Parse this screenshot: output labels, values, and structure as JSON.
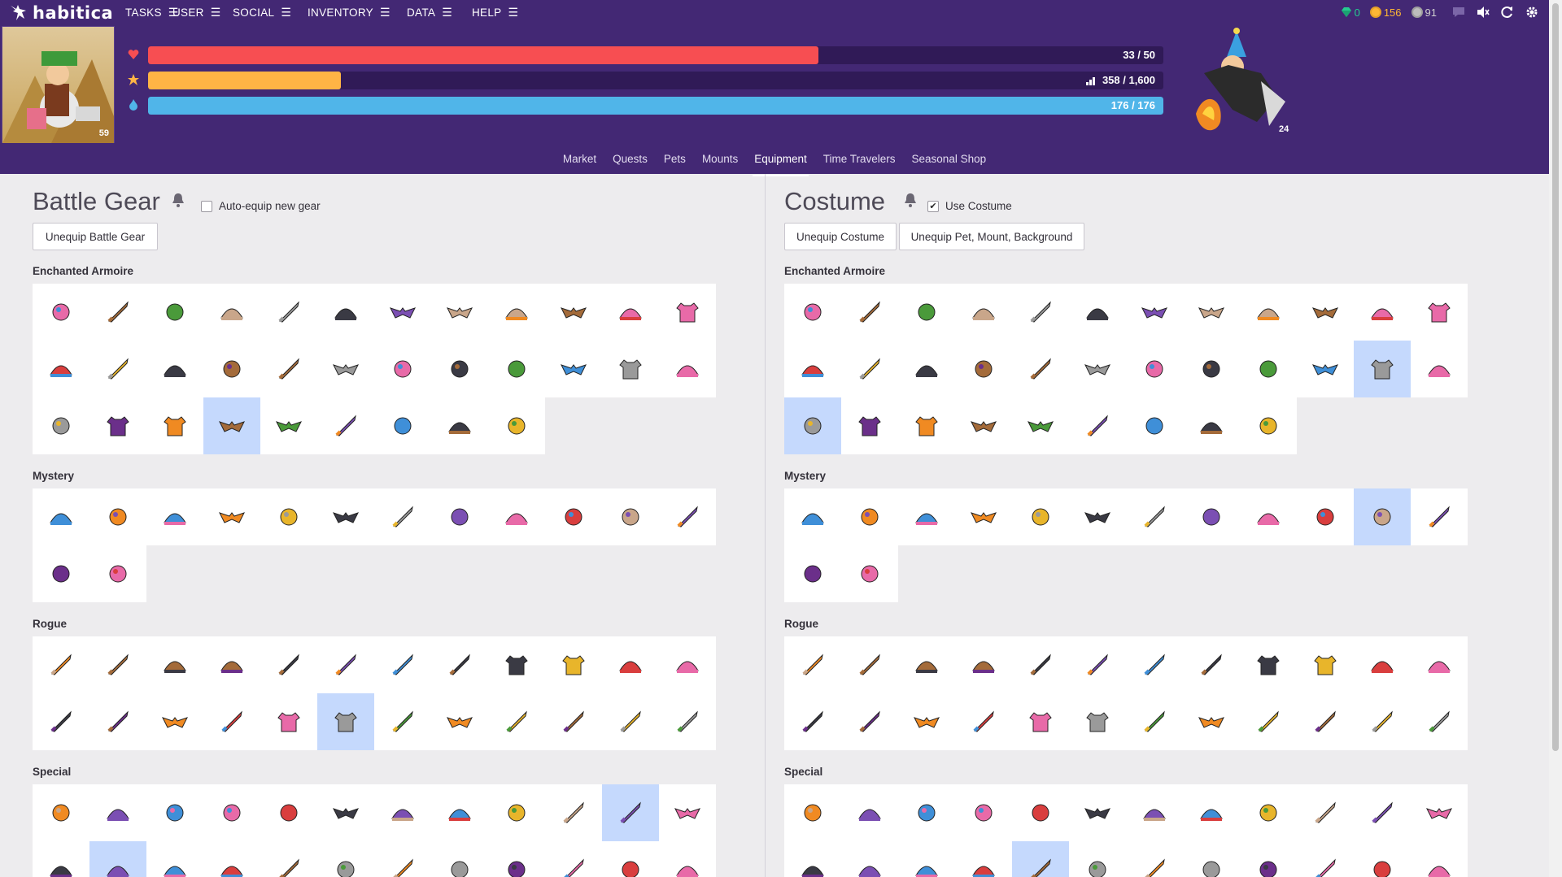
{
  "brand": {
    "name": "habitica"
  },
  "nav": {
    "items": [
      {
        "label": "TASKS"
      },
      {
        "label": "USER"
      },
      {
        "label": "SOCIAL"
      },
      {
        "label": "INVENTORY"
      },
      {
        "label": "DATA"
      },
      {
        "label": "HELP"
      }
    ],
    "gems": "0",
    "gold": "156",
    "silver": "91"
  },
  "stats": {
    "health": {
      "label": "33 / 50",
      "fraction": 0.66,
      "color": "#f74e52"
    },
    "experience": {
      "label": "358 / 1,600",
      "fraction": 0.19,
      "color": "#ffb445"
    },
    "mana": {
      "label": "176 / 176",
      "fraction": 1.0,
      "color": "#50b5e9"
    }
  },
  "avatar": {
    "level": "59"
  },
  "party_member": {
    "level": "24"
  },
  "tabs": [
    {
      "label": "Market",
      "active": false
    },
    {
      "label": "Quests",
      "active": false
    },
    {
      "label": "Pets",
      "active": false
    },
    {
      "label": "Mounts",
      "active": false
    },
    {
      "label": "Equipment",
      "active": true
    },
    {
      "label": "Time Travelers",
      "active": false
    },
    {
      "label": "Seasonal Shop",
      "active": false
    }
  ],
  "battle": {
    "title": "Battle Gear",
    "checkbox_label": "Auto-equip new gear",
    "checkbox_checked": false,
    "buttons": [
      "Unequip Battle Gear"
    ]
  },
  "costume": {
    "title": "Costume",
    "checkbox_label": "Use Costume",
    "checkbox_checked": true,
    "buttons": [
      "Unequip Costume",
      "Unequip Pet, Mount, Background"
    ]
  },
  "sections": {
    "armoire": "Enchanted Armoire",
    "mystery": "Mystery",
    "rogue": "Rogue",
    "special": "Special"
  },
  "selected": {
    "battle": {
      "armoire": 27,
      "mystery": -1,
      "rogue": 17,
      "special": 10,
      "special2": 1
    },
    "costume": {
      "armoire": [
        22,
        24
      ],
      "mystery": 10,
      "rogue": -1,
      "special": -1,
      "special2": 4
    }
  },
  "icons": {
    "armoire": [
      "bug-icon",
      "dagger-icon",
      "rope-icon",
      "golden-helm-icon",
      "hammer-icon",
      "purple-hat-icon",
      "skull-mask-icon",
      "red-bow-icon",
      "yellow-horns-icon",
      "black-mask-icon",
      "crown-icon",
      "gold-armor-icon",
      "red-cap-icon",
      "pickaxe-icon",
      "tan-hat-icon",
      "fish-icon",
      "magnifier-icon",
      "animal-mask-icon",
      "gray-fish-icon",
      "cat-ears-icon",
      "purple-gem-icon",
      "blue-bow-icon",
      "orange-armor-icon",
      "wizard-hat-icon",
      "red-shield-icon",
      "dark-armor-icon",
      "dark-shirt-icon",
      "bird-icon",
      "yellow-glasses-icon",
      "crook-icon",
      "chain-icon",
      "headband-icon",
      "flower-icon"
    ],
    "mystery": [
      "green-horns-icon",
      "snake-icon",
      "brown-hat-icon",
      "bat-icon",
      "blue-flame-icon",
      "blue-wings-icon",
      "hook-icon",
      "yellow-mustache-icon",
      "top-hat-icon",
      "ball-icon",
      "green-crab-icon",
      "green-sword-icon",
      "clown-icon",
      "red-lips-icon"
    ],
    "rogue": [
      "small-dagger-icon",
      "dagger-icon",
      "leather-cap-icon",
      "hood-icon",
      "blade-icon",
      "blade-icon",
      "sabre-icon",
      "scimitar-icon",
      "leather-armor-icon",
      "green-armor-icon",
      "dark-hood-icon",
      "green-hood-icon",
      "boomerang-icon",
      "hook-blade-icon",
      "black-mask-icon",
      "long-knife-icon",
      "black-armor-icon",
      "black-armor-icon",
      "curved-blade-icon",
      "masked-head-icon",
      "sickle-icon",
      "long-sword-icon",
      "claw-icon",
      "spear-icon"
    ],
    "special": [
      "winged-beast-icon",
      "party-hat-icon",
      "blue-ship-icon",
      "trophy-icon",
      "orb-icon",
      "purple-bat-icon",
      "green-helm-icon",
      "white-helm-icon",
      "amulet-icon",
      "torch-icon",
      "hammer-icon",
      "pink-wings-icon"
    ],
    "special2": [
      "pink-helm-icon",
      "red-crown-icon",
      "blue-helm-icon",
      "blue-crown-icon",
      "red-sword-icon",
      "blue-wizard-icon",
      "candle-icon",
      "small-gem-icon",
      "white-cat-icon",
      "golden-staff-icon",
      "pixel-orb-icon",
      "dark-horns-icon"
    ]
  }
}
